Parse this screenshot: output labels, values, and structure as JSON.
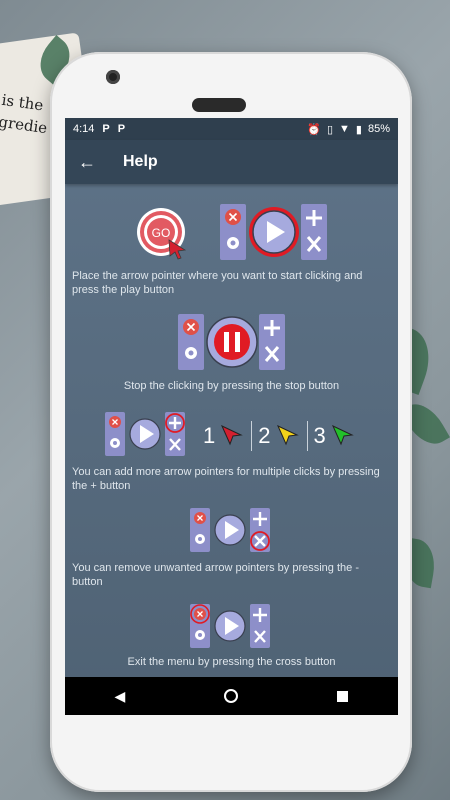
{
  "background": {
    "paper_text": "is the\ngredie"
  },
  "statusbar": {
    "time": "4:14",
    "battery": "85%"
  },
  "appbar": {
    "title": "Help"
  },
  "sections": [
    {
      "caption": "Place the arrow pointer where you want to start clicking and press the play button"
    },
    {
      "caption": "Stop the clicking by pressing the stop button"
    },
    {
      "caption": "You can add more arrow pointers for multiple clicks by pressing the + button",
      "numbers": [
        "1",
        "2",
        "3"
      ]
    },
    {
      "caption": "You can remove unwanted arrow pointers by pressing the - button"
    },
    {
      "caption": "Exit the menu by pressing the cross button"
    }
  ],
  "go_label": "GO",
  "colors": {
    "pointer1": "#d42030",
    "pointer2": "#f2d21a",
    "pointer3": "#22c02a",
    "panel": "#8d8fc9",
    "close": "#e05048"
  }
}
